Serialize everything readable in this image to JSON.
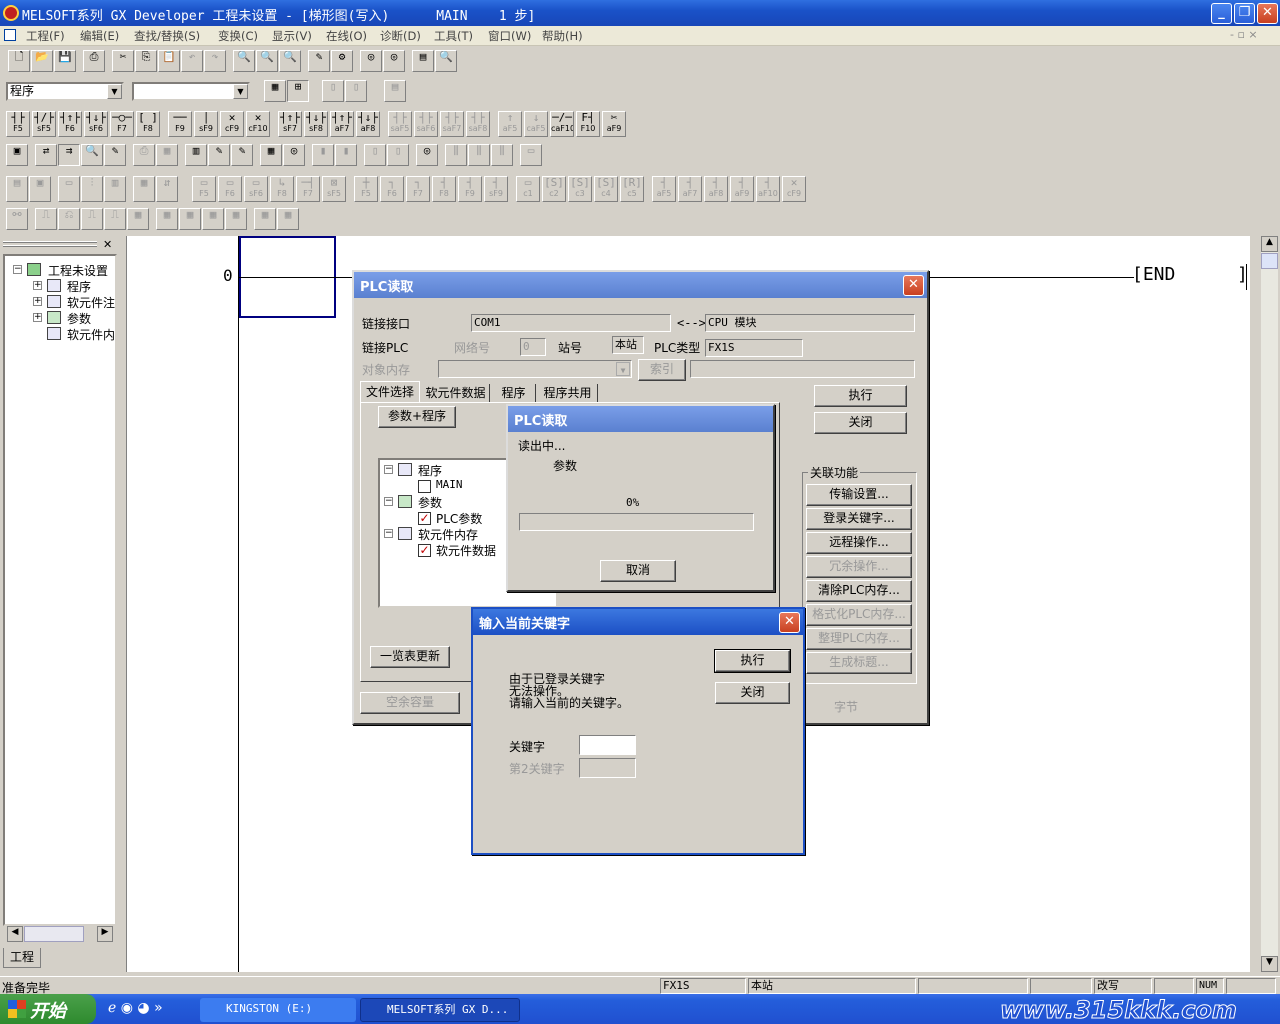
{
  "window": {
    "title": "MELSOFT系列 GX Developer 工程未设置 - [梯形图(写入)      MAIN    1 步]"
  },
  "menu": [
    "工程(F)",
    "编辑(E)",
    "查找/替换(S)",
    "变换(C)",
    "显示(V)",
    "在线(O)",
    "诊断(D)",
    "工具(T)",
    "窗口(W)",
    "帮助(H)"
  ],
  "toolbar": {
    "program_combo": "程序",
    "fkeys": [
      "F5",
      "sF5",
      "F6",
      "sF6",
      "F7",
      "F8",
      "F9",
      "sF9",
      "cF9",
      "cF10",
      "sF7",
      "sF8",
      "aF7",
      "aF8",
      "saF5",
      "saF6",
      "saF7",
      "saF8",
      "aF5",
      "caF5",
      "caF10",
      "F10",
      "aF9"
    ],
    "fkeys2": [
      "F5",
      "F6",
      "sF6",
      "F8",
      "F7",
      "sF5",
      "F5",
      "F6",
      "F7",
      "F8",
      "F9",
      "sF9",
      "c1",
      "c2",
      "c3",
      "c4",
      "c5",
      "aF5",
      "aF7",
      "aF8",
      "aF9",
      "aF10",
      "cF9"
    ]
  },
  "project_tree": {
    "root": "工程未设置",
    "items": [
      "程序",
      "软元件注",
      "参数",
      "软元件内"
    ],
    "tab": "工程"
  },
  "ladder": {
    "step": "0",
    "end_label": "END"
  },
  "plc_read_dialog": {
    "title": "PLC读取",
    "link_interface_label": "链接接口",
    "link_interface_value": "COM1",
    "arrow": "<-->",
    "cpu_module": "CPU 模块",
    "link_plc_label": "链接PLC",
    "network_label": "网络号",
    "network_value": "0",
    "station_label": "站号",
    "station_value": "本站",
    "plc_type_label": "PLC类型",
    "plc_type_value": "FX1S",
    "target_memory_label": "对象内存",
    "index_button": "索引",
    "tabs": [
      "文件选择",
      "软元件数据",
      "程序",
      "程序共用"
    ],
    "param_program_button": "参数+程序",
    "tree": {
      "program": "程序",
      "main": "MAIN",
      "param": "参数",
      "plc_param": "PLC参数",
      "device_memory": "软元件内存",
      "device_data": "软元件数据"
    },
    "refresh_button": "一览表更新",
    "free_capacity_button": "空余容量",
    "bytes_label": "字节",
    "execute_button": "执行",
    "close_button": "关闭",
    "related_label": "关联功能",
    "related_buttons": [
      "传输设置...",
      "登录关键字...",
      "远程操作...",
      "冗余操作...",
      "清除PLC内存...",
      "格式化PLC内存...",
      "整理PLC内存...",
      "生成标题..."
    ]
  },
  "progress_dialog": {
    "title": "PLC读取",
    "status": "读出中...",
    "item": "参数",
    "percent": "0%",
    "progress": 0,
    "cancel_button": "取消"
  },
  "keyword_dialog": {
    "title": "输入当前关键字",
    "message_line1": "由于已登录关键字",
    "message_line2": "无法操作。",
    "message_line3": "请输入当前的关键字。",
    "execute_button": "执行",
    "close_button": "关闭",
    "keyword_label": "关键字",
    "keyword_value": "",
    "keyword2_label": "第2关键字"
  },
  "statusbar": {
    "ready": "准备完毕",
    "plc": "FX1S",
    "station": "本站",
    "mode": "改写",
    "num": "NUM"
  },
  "taskbar": {
    "start": "开始",
    "tasks": [
      "KINGSTON (E:)",
      "MELSOFT系列 GX D..."
    ],
    "watermark": "www.315kkk.com"
  }
}
